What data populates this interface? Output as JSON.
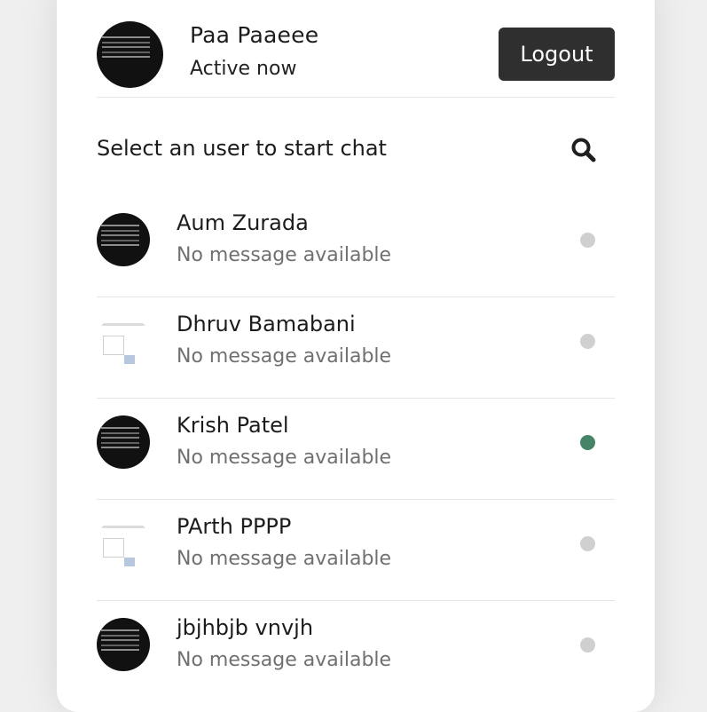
{
  "header": {
    "name": "Paa Paaeee",
    "status": "Active now",
    "logout_label": "Logout"
  },
  "search": {
    "prompt": "Select an user to start chat",
    "icon": "search-icon"
  },
  "users": [
    {
      "name": "Aum Zurada",
      "message": "No message available",
      "online": false,
      "avatar_style": "dark"
    },
    {
      "name": "Dhruv Bamabani",
      "message": "No message available",
      "online": false,
      "avatar_style": "light"
    },
    {
      "name": "Krish Patel",
      "message": "No message available",
      "online": true,
      "avatar_style": "dark"
    },
    {
      "name": "PArth PPPP",
      "message": "No message available",
      "online": false,
      "avatar_style": "light"
    },
    {
      "name": "jbjhbjb vnvjh",
      "message": "No message available",
      "online": false,
      "avatar_style": "dark"
    }
  ],
  "colors": {
    "online": "#468468",
    "offline": "#d0d0d0",
    "button_bg": "#2f2f2f"
  }
}
